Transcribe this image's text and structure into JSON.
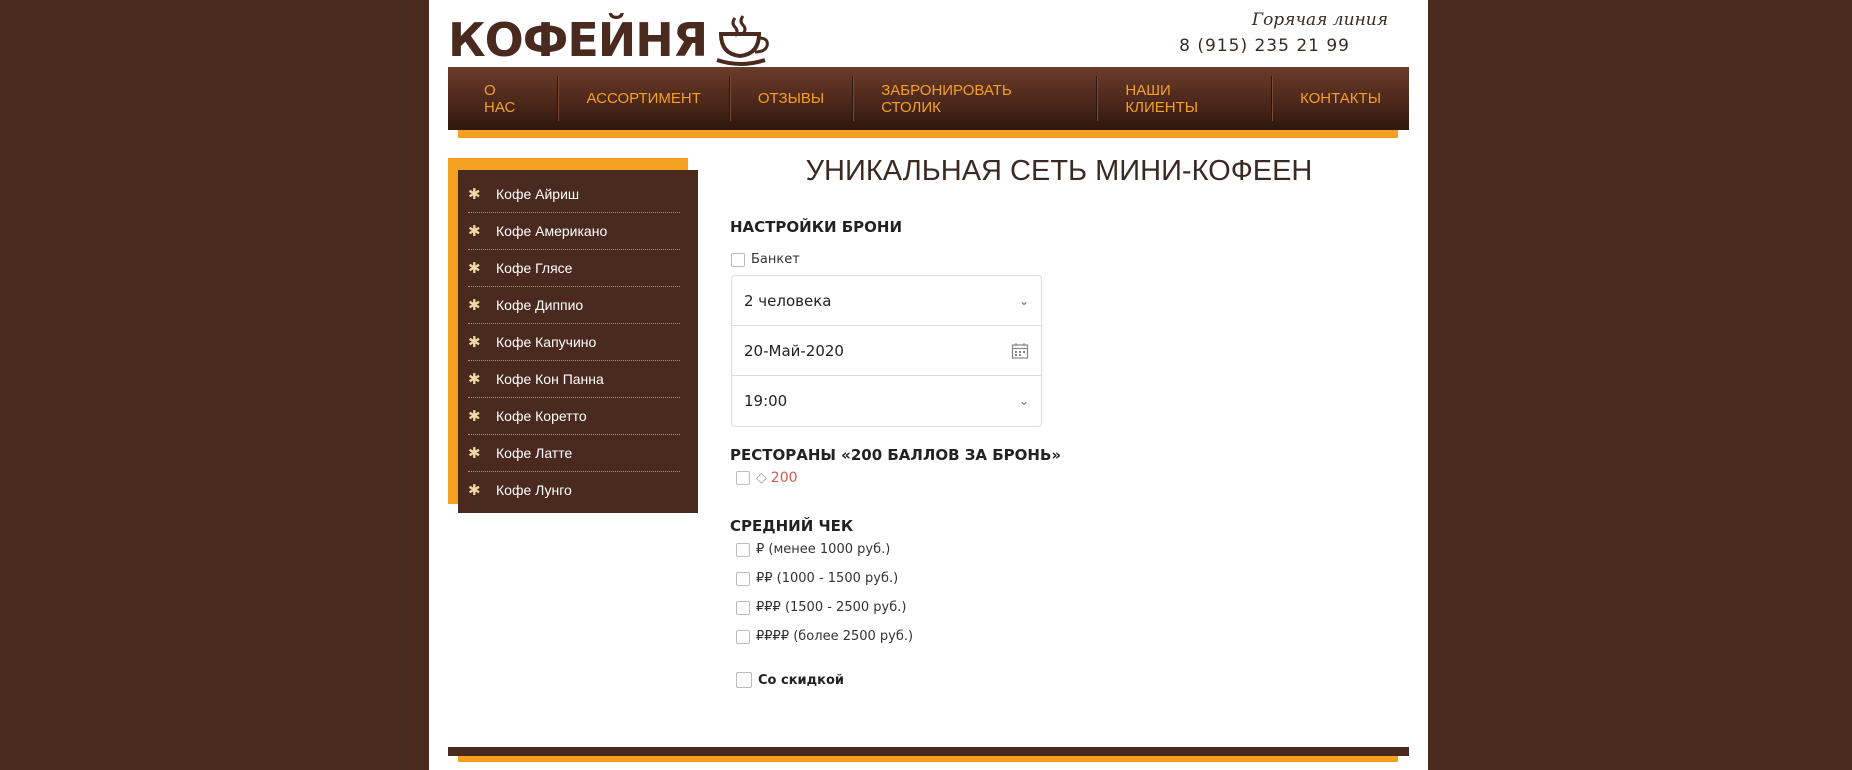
{
  "header": {
    "logo_text": "КОФЕЙНЯ",
    "hotline_label": "Горячая линия",
    "hotline_phone": "8 (915) 235 21 99"
  },
  "nav": {
    "items": [
      "О НАС",
      "АССОРТИМЕНТ",
      "ОТЗЫВЫ",
      "ЗАБРОНИРОВАТЬ СТОЛИК",
      "НАШИ КЛИЕНТЫ",
      "КОНТАКТЫ"
    ]
  },
  "sidebar": {
    "items": [
      {
        "label": "Кофе Айриш",
        "icon": "flower-bullet-icon"
      },
      {
        "label": "Кофе Американо",
        "icon": "flower-bullet-icon"
      },
      {
        "label": "Кофе Глясе",
        "icon": "flower-bullet-icon"
      },
      {
        "label": "Кофе Диппио",
        "icon": "flower-bullet-icon"
      },
      {
        "label": "Кофе Капучино",
        "icon": "flower-bullet-icon"
      },
      {
        "label": "Кофе Кон Панна",
        "icon": "flower-bullet-icon"
      },
      {
        "label": "Кофе Коретто",
        "icon": "flower-bullet-icon"
      },
      {
        "label": "Кофе Латте",
        "icon": "flower-bullet-icon"
      },
      {
        "label": "Кофе Лунго",
        "icon": "flower-bullet-icon"
      }
    ]
  },
  "main": {
    "title": "УНИКАЛЬНАЯ СЕТЬ МИНИ-КОФЕЕН",
    "booking": {
      "title": "НАСТРОЙКИ БРОНИ",
      "banquet_label": "Банкет",
      "guests_value": "2 человека",
      "date_value": "20-Май-2020",
      "time_value": "19:00"
    },
    "restaurants": {
      "title": "РЕСТОРАНЫ «200 БАЛЛОВ ЗА БРОНЬ»",
      "points": "200"
    },
    "avg_check": {
      "title": "СРЕДНИЙ ЧЕК",
      "options": [
        "₽ (менее 1000 руб.)",
        "₽₽ (1000 - 1500 руб.)",
        "₽₽₽ (1500 - 2500 руб.)",
        "₽₽₽₽ (более 2500 руб.)"
      ]
    },
    "discount_label": "Со скидкой"
  },
  "colors": {
    "background": "#4a2a1f",
    "accent": "#f4a020",
    "nav_text": "#f4a020",
    "points": "#d05a4a"
  }
}
